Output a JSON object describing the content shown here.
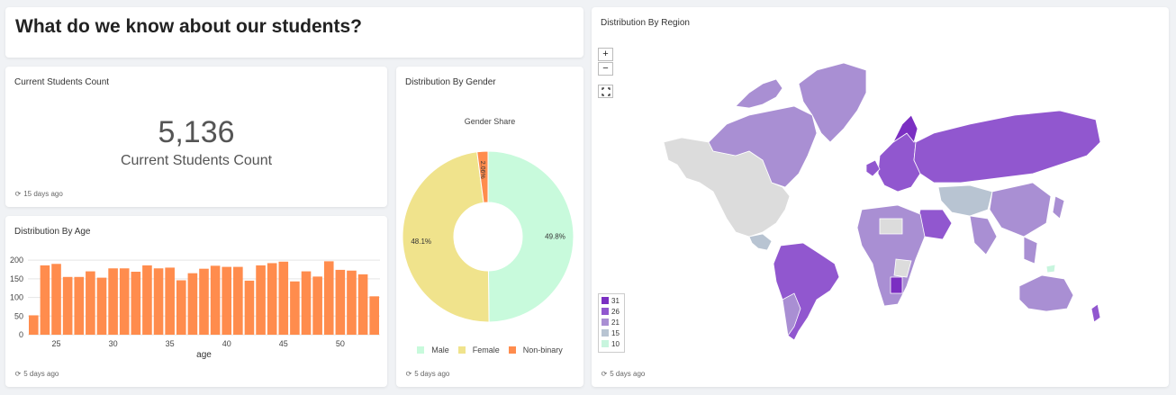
{
  "header": {
    "title": "What do we know about our students?"
  },
  "students_count": {
    "title": "Current Students Count",
    "value": "5,136",
    "subtitle": "Current Students Count",
    "refreshed": "15 days ago"
  },
  "age": {
    "title": "Distribution By Age",
    "refreshed": "5 days ago"
  },
  "gender": {
    "title": "Distribution By Gender",
    "refreshed": "5 days ago"
  },
  "region": {
    "title": "Distribution By Region",
    "refreshed": "5 days ago",
    "zoom_in": "+",
    "zoom_out": "−",
    "legend": [
      {
        "label": "31",
        "color": "#7b2fc2"
      },
      {
        "label": "26",
        "color": "#9157cf"
      },
      {
        "label": "21",
        "color": "#a98fd3"
      },
      {
        "label": "15",
        "color": "#b8c4d2"
      },
      {
        "label": "10",
        "color": "#c8f5de"
      }
    ]
  },
  "chart_data": [
    {
      "type": "bar",
      "title": "",
      "xlabel": "age",
      "ylabel": "",
      "color": "#ff8c4d",
      "x": [
        23,
        24,
        25,
        26,
        27,
        28,
        29,
        30,
        31,
        32,
        33,
        34,
        35,
        36,
        37,
        38,
        39,
        40,
        41,
        42,
        43,
        44,
        45,
        46,
        47,
        48,
        49,
        50,
        51,
        52,
        53,
        54
      ],
      "values": [
        52,
        186,
        190,
        155,
        155,
        170,
        153,
        178,
        178,
        169,
        186,
        178,
        180,
        146,
        165,
        177,
        185,
        182,
        182,
        145,
        186,
        192,
        196,
        143,
        170,
        156,
        197,
        174,
        172,
        162,
        103
      ],
      "xticks": [
        25,
        30,
        35,
        40,
        45,
        50
      ],
      "yticks": [
        0,
        50,
        100,
        150,
        200
      ],
      "ylim": [
        0,
        210
      ],
      "xlim": [
        23,
        54
      ]
    },
    {
      "type": "pie",
      "title": "Gender Share",
      "donut": true,
      "categories": [
        "Male",
        "Female",
        "Non-binary"
      ],
      "values": [
        49.8,
        48.1,
        2.06
      ],
      "labels": [
        "49.8%",
        "48.1%",
        "2.06%"
      ],
      "colors": [
        "#c8fadc",
        "#f0e38c",
        "#ff8c4d"
      ]
    }
  ]
}
